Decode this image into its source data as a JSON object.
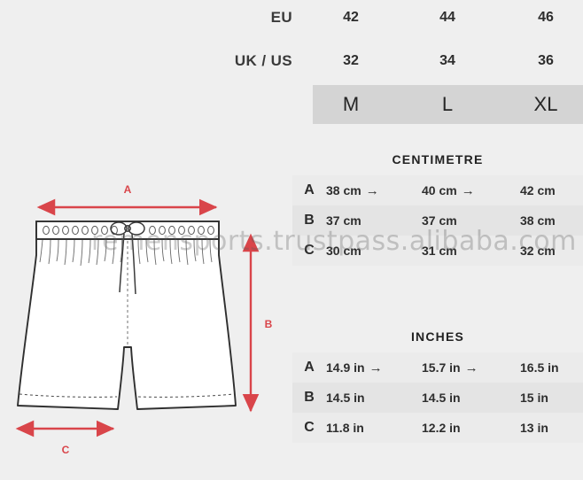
{
  "size_conversion": {
    "rows": [
      {
        "label": "EU",
        "values": [
          "42",
          "44",
          "46"
        ]
      },
      {
        "label": "UK / US",
        "values": [
          "32",
          "34",
          "36"
        ]
      }
    ],
    "size_bar": {
      "values": [
        "M",
        "L",
        "XL"
      ],
      "background": "#d4d4d4"
    }
  },
  "tables": [
    {
      "caption": "CENTIMETRE",
      "rows": [
        {
          "key": "A",
          "cells": [
            "38 cm",
            "40 cm",
            "42 cm"
          ],
          "arrows": [
            true,
            true,
            false
          ]
        },
        {
          "key": "B",
          "cells": [
            "37 cm",
            "37 cm",
            "38 cm"
          ],
          "arrows": [
            false,
            false,
            false
          ]
        },
        {
          "key": "C",
          "cells": [
            "30 cm",
            "31 cm",
            "32 cm"
          ],
          "arrows": [
            false,
            false,
            false
          ]
        }
      ]
    },
    {
      "caption": "INCHES",
      "rows": [
        {
          "key": "A",
          "cells": [
            "14.9 in",
            "15.7 in",
            "16.5 in"
          ],
          "arrows": [
            true,
            true,
            false
          ]
        },
        {
          "key": "B",
          "cells": [
            "14.5 in",
            "14.5 in",
            "15 in"
          ],
          "arrows": [
            false,
            false,
            false
          ]
        },
        {
          "key": "C",
          "cells": [
            "11.8 in",
            "12.2 in",
            "13 in"
          ],
          "arrows": [
            false,
            false,
            false
          ]
        }
      ]
    }
  ],
  "diagram": {
    "measure_a": "A",
    "measure_b": "B",
    "measure_c": "C",
    "arrow_color": "#d9454a",
    "garment": "mens-shorts-technical-drawing"
  },
  "watermark": {
    "text": "remensports.trustpass.alibaba.com"
  },
  "icons": {
    "arrow_right": "→"
  },
  "theme": {
    "page_background": "#efefef",
    "row_odd": "#ebebeb",
    "row_even": "#e4e4e4",
    "text": "#2b2b2b"
  }
}
